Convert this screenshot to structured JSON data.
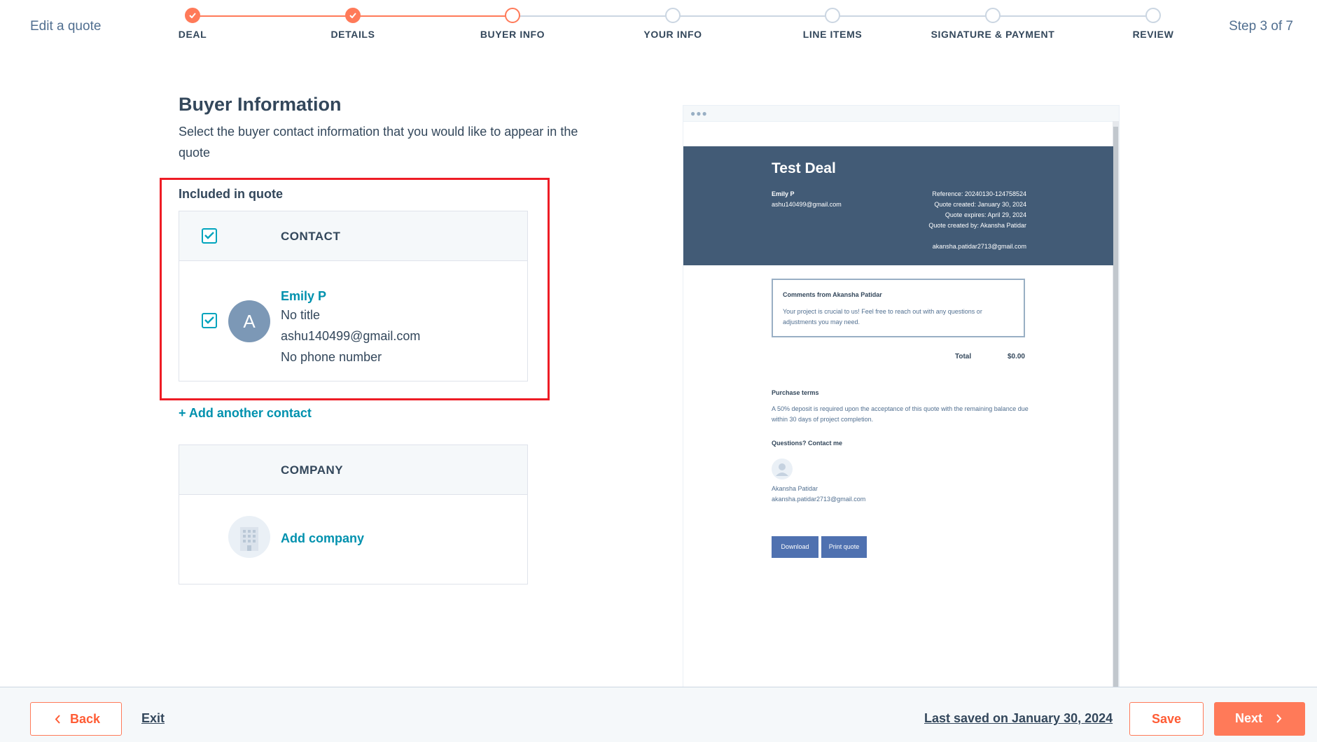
{
  "header": {
    "title": "Edit a quote",
    "step_count": "Step 3 of 7",
    "steps": [
      {
        "label": "DEAL",
        "state": "done"
      },
      {
        "label": "DETAILS",
        "state": "done"
      },
      {
        "label": "BUYER INFO",
        "state": "current"
      },
      {
        "label": "YOUR INFO",
        "state": "todo"
      },
      {
        "label": "LINE ITEMS",
        "state": "todo"
      },
      {
        "label": "SIGNATURE & PAYMENT",
        "state": "todo"
      },
      {
        "label": "REVIEW",
        "state": "todo"
      }
    ]
  },
  "main": {
    "title": "Buyer Information",
    "description": "Select the buyer contact information that you would like to appear in the quote",
    "included_label": "Included in quote",
    "contact_card": {
      "header": "CONTACT",
      "header_checked": true,
      "contact": {
        "checked": true,
        "avatar_initial": "A",
        "name": "Emily P",
        "title": "No title",
        "email": "ashu140499@gmail.com",
        "phone": "No phone number"
      }
    },
    "add_contact": "+ Add another contact",
    "company_card": {
      "header": "COMPANY",
      "add_company": "Add company"
    }
  },
  "preview": {
    "deal_title": "Test Deal",
    "buyer_name": "Emily P",
    "buyer_email": "ashu140499@gmail.com",
    "reference": "Reference: 20240130-124758524",
    "created": "Quote created: January 30, 2024",
    "expires": "Quote expires: April 29, 2024",
    "created_by": "Quote created by: Akansha Patidar",
    "creator_email": "akansha.patidar2713@gmail.com",
    "comments_heading": "Comments from Akansha Patidar",
    "comments_body": "Your project is crucial to us! Feel free to reach out with any questions or adjustments you may need.",
    "total_label": "Total",
    "total_value": "$0.00",
    "purchase_terms_heading": "Purchase terms",
    "purchase_terms_body": "A 50% deposit is required upon the acceptance of this quote with the remaining balance due within 30 days of project completion.",
    "questions_heading": "Questions? Contact me",
    "contact_name": "Akansha Patidar",
    "contact_email": "akansha.patidar2713@gmail.com",
    "download_label": "Download",
    "print_label": "Print quote"
  },
  "footer": {
    "back_label": "Back",
    "exit_label": "Exit",
    "last_saved": "Last saved on January 30, 2024",
    "save_label": "Save",
    "next_label": "Next"
  },
  "colors": {
    "accent": "#ff7a59",
    "link": "#0091ae",
    "checkbox": "#00a4bd",
    "preview_header": "#425b76",
    "highlight_box": "#ee1c25"
  }
}
